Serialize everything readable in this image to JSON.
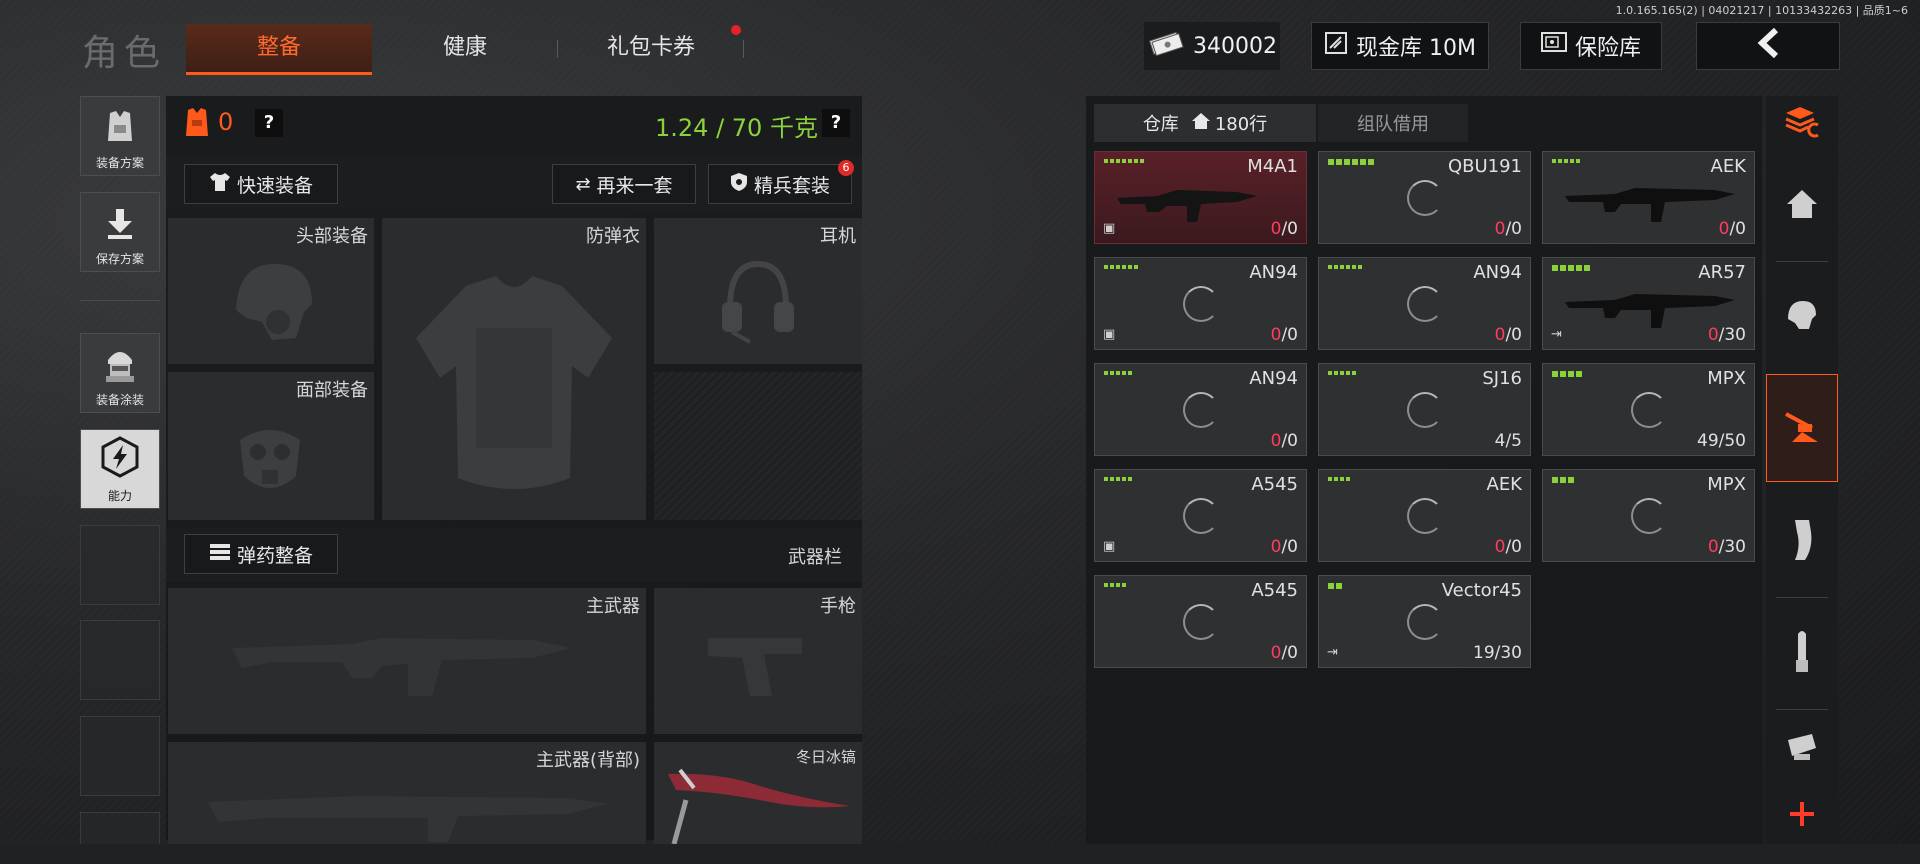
{
  "version": "1.0.165.165(2) | 04021217 | 10133432263 | 品质1~6",
  "header": {
    "title": "角色",
    "tabs": [
      {
        "label": "整备",
        "active": true
      },
      {
        "label": "健康",
        "active": false
      },
      {
        "label": "礼包卡券",
        "active": false,
        "badge_dot": true
      }
    ],
    "currency": "340002",
    "cash_vault_label": "现金库 10M",
    "safe_label": "保险库",
    "back_icon": "chevron-left-icon"
  },
  "sidebar": {
    "items": [
      {
        "label": "装备方案",
        "icon": "vest-icon"
      },
      {
        "label": "保存方案",
        "icon": "download-arrow-icon"
      },
      {
        "label": "装备涂装",
        "icon": "operator-head-icon"
      },
      {
        "label": "能力",
        "icon": "lightning-hex-icon",
        "active": true
      }
    ]
  },
  "loadout": {
    "armor_count": "0",
    "weight": "1.24 / 70 千克",
    "help": "?",
    "quick_equip": "快速装备",
    "another_set": "再来一套",
    "elite_set": "精兵套装",
    "elite_badge": "6",
    "slots": {
      "head": "头部装备",
      "armor": "防弹衣",
      "headset": "耳机",
      "face": "面部装备"
    },
    "ammo_button": "弹药整备",
    "weapon_bar": "武器栏",
    "weapons": {
      "primary": "主武器",
      "pistol": "手枪",
      "primary_back": "主武器(背部)",
      "melee": "冬日冰镐"
    }
  },
  "warehouse": {
    "tab_label": "仓库",
    "rows": "180行",
    "team_tab": "组队借用",
    "items": [
      {
        "name": "M4A1",
        "cur": "0",
        "max": "/0",
        "dots": 7,
        "selected": true,
        "corner": "box"
      },
      {
        "name": "QBU191",
        "cur": "0",
        "max": "/0",
        "dots": 6,
        "big": true
      },
      {
        "name": "AEK",
        "cur": "0",
        "max": "/0",
        "dots": 5
      },
      {
        "name": "AN94",
        "cur": "0",
        "max": "/0",
        "dots": 6,
        "corner": "box"
      },
      {
        "name": "AN94",
        "cur": "0",
        "max": "/0",
        "dots": 6
      },
      {
        "name": "AR57",
        "cur": "0",
        "max": "/30",
        "dots": 5,
        "big": true,
        "corner": "exit"
      },
      {
        "name": "AN94",
        "cur": "0",
        "max": "/0",
        "dots": 5
      },
      {
        "name": "SJ16",
        "cur": "4",
        "max": "/5",
        "dots": 5,
        "plain": true
      },
      {
        "name": "MPX",
        "cur": "49",
        "max": "/50",
        "dots": 4,
        "big": true,
        "plain": true
      },
      {
        "name": "A545",
        "cur": "0",
        "max": "/0",
        "dots": 5,
        "corner": "box"
      },
      {
        "name": "AEK",
        "cur": "0",
        "max": "/0",
        "dots": 4
      },
      {
        "name": "MPX",
        "cur": "0",
        "max": "/30",
        "dots": 3,
        "big": true
      },
      {
        "name": "A545",
        "cur": "0",
        "max": "/0",
        "dots": 4
      },
      {
        "name": "Vector45",
        "cur": "19",
        "max": "/30",
        "dots": 2,
        "big": true,
        "plain": true,
        "corner": "exit"
      }
    ]
  },
  "rail": {
    "icons": [
      "stack-sort-icon",
      "home-icon",
      "helmet-icon",
      "turret-icon",
      "magazine-icon",
      "bullet-icon",
      "scope-icon",
      "plus-icon"
    ],
    "active_index": 3
  },
  "colors": {
    "accent": "#ff5a1c",
    "green": "#8bd13c",
    "red_value": "#ff3b5e"
  }
}
